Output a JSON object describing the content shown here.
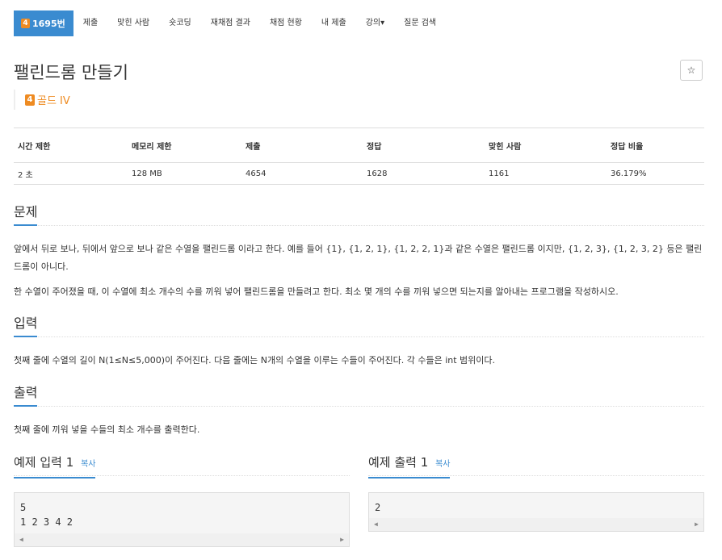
{
  "nav": {
    "tier_num": "4",
    "problem_label": "1695번",
    "items": [
      "제출",
      "맞힌 사람",
      "숏코딩",
      "재채점 결과",
      "채점 현황",
      "내 제출",
      "강의▾",
      "질문 검색"
    ]
  },
  "title": "팰린드롬 만들기",
  "star": "☆",
  "tier": {
    "num": "4",
    "label": "골드 IV",
    "color": "#ee8b22"
  },
  "stats": {
    "headers": [
      "시간 제한",
      "메모리 제한",
      "제출",
      "정답",
      "맞힌 사람",
      "정답 비율"
    ],
    "values": [
      "2 초",
      "128 MB",
      "4654",
      "1628",
      "1161",
      "36.179%"
    ]
  },
  "sections": {
    "problem": {
      "heading": "문제",
      "p1": "앞에서 뒤로 보나, 뒤에서 앞으로 보나 같은 수열을 팰린드롬 이라고 한다. 예를 들어 {1}, {1, 2, 1}, {1, 2, 2, 1}과 같은 수열은 팰린드롬 이지만, {1, 2, 3}, {1, 2, 3, 2} 등은 팰린드롬이 아니다.",
      "p2": "한 수열이 주어졌을 때, 이 수열에 최소 개수의 수를 끼워 넣어 팰린드롬을 만들려고 한다. 최소 몇 개의 수를 끼워 넣으면 되는지를 알아내는 프로그램을 작성하시오."
    },
    "input": {
      "heading": "입력",
      "p1": "첫째 줄에 수열의 길이 N(1≤N≤5,000)이 주어진다. 다음 줄에는 N개의 수열을 이루는 수들이 주어진다. 각 수들은 int 범위이다."
    },
    "output": {
      "heading": "출력",
      "p1": "첫째 줄에 끼워 넣을 수들의 최소 개수를 출력한다."
    }
  },
  "examples": {
    "input": {
      "label": "예제 입력 1",
      "copy": "복사",
      "content": "5\n1 2 3 4 2"
    },
    "output": {
      "label": "예제 출력 1",
      "copy": "복사",
      "content": "2"
    }
  },
  "colors": {
    "accent": "#3a8bd0",
    "gold": "#ee8b22"
  }
}
